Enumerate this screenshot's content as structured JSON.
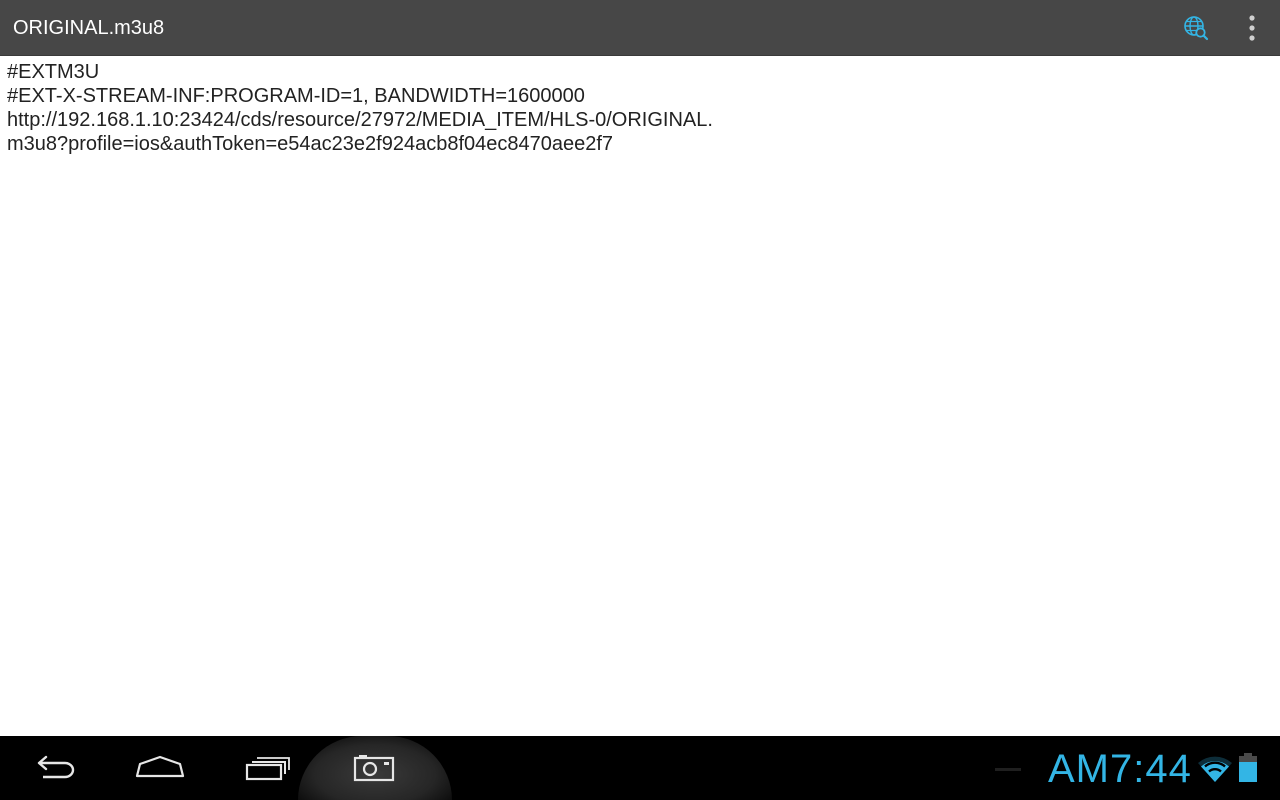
{
  "action_bar": {
    "title": "ORIGINAL.m3u8",
    "icons": [
      "globe-search-icon",
      "overflow-menu-icon"
    ]
  },
  "content": {
    "lines": [
      "#EXTM3U",
      "#EXT-X-STREAM-INF:PROGRAM-ID=1, BANDWIDTH=1600000",
      "http://192.168.1.10:23424/cds/resource/27972/MEDIA_ITEM/HLS-0/ORIGINAL.",
      "m3u8?profile=ios&authToken=e54ac23e2f924acb8f04ec8470aee2f7"
    ]
  },
  "status_bar": {
    "clock": "AM7:44"
  },
  "colors": {
    "action_bar_bg": "#474747",
    "nav_bar_bg": "#000000",
    "accent_blue": "#33b5e5",
    "text": "#222222"
  }
}
